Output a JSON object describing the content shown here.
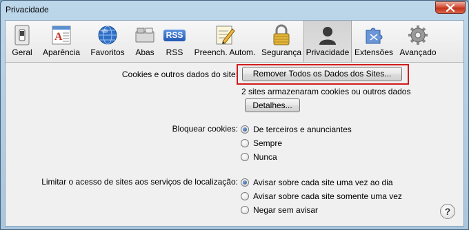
{
  "window": {
    "title": "Privacidade"
  },
  "toolbar": {
    "tabs": [
      {
        "label": "Geral",
        "icon": "switch-icon"
      },
      {
        "label": "Aparência",
        "icon": "typography-icon"
      },
      {
        "label": "Favoritos",
        "icon": "globe-icon"
      },
      {
        "label": "Abas",
        "icon": "tabs-icon"
      },
      {
        "label": "RSS",
        "icon": "rss-icon"
      },
      {
        "label": "Preench. Autom.",
        "icon": "pencil-form-icon"
      },
      {
        "label": "Segurança",
        "icon": "lock-icon"
      },
      {
        "label": "Privacidade",
        "icon": "person-silhouette-icon"
      },
      {
        "label": "Extensões",
        "icon": "puzzle-icon"
      },
      {
        "label": "Avançado",
        "icon": "gear-icon"
      }
    ],
    "selected_tab": "Privacidade",
    "rss_badge": "RSS"
  },
  "cookies": {
    "label": "Cookies e outros dados do site:",
    "remove_button": "Remover Todos os Dados dos Sites...",
    "info": "2 sites armazenaram cookies ou outros dados",
    "details_button": "Detalhes..."
  },
  "block_cookies": {
    "label": "Bloquear cookies:",
    "options": [
      "De terceiros e anunciantes",
      "Sempre",
      "Nunca"
    ],
    "selected": "De terceiros e anunciantes"
  },
  "location": {
    "label": "Limitar o acesso de sites aos serviços de localização:",
    "options": [
      "Avisar sobre cada site uma vez ao dia",
      "Avisar sobre cada site somente uma vez",
      "Negar sem avisar"
    ],
    "selected": "Avisar sobre cada site uma vez ao dia"
  },
  "help": {
    "glyph": "?"
  },
  "colors": {
    "highlight": "#d11a1a",
    "radio_selected": "#1d4e8f"
  }
}
